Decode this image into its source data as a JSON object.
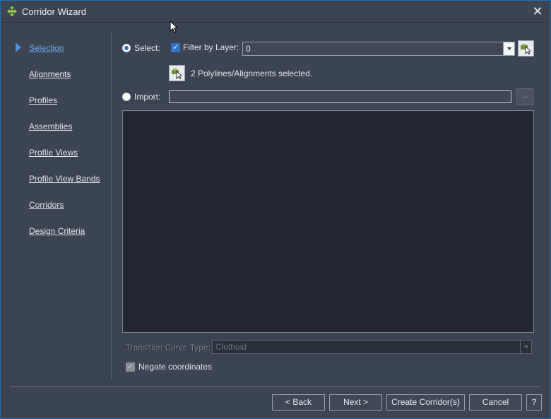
{
  "window": {
    "title": "Corridor Wizard",
    "close_glyph": "✕"
  },
  "nav": {
    "items": [
      {
        "label": "Selection",
        "active": true
      },
      {
        "label": "Alignments"
      },
      {
        "label": "Profiles"
      },
      {
        "label": "Assemblies"
      },
      {
        "label": "Profile Views"
      },
      {
        "label": "Profile View Bands"
      },
      {
        "label": "Corridors"
      },
      {
        "label": "Design Criteria"
      }
    ]
  },
  "selection": {
    "select_label": "Select:",
    "select_checked": true,
    "filter_label": "Filter by Layer:",
    "filter_checked": true,
    "layer_value": "0",
    "status_text": "2 Polylines/Alignments selected.",
    "import_label": "Import:",
    "import_value": "",
    "browse_label": "...",
    "transition_label": "Transition Curve Type:",
    "transition_value": "Clothoid",
    "negate_label": "Negate coordinates",
    "negate_checked": true
  },
  "buttons": {
    "back": "< Back",
    "next": "Next >",
    "create": "Create Corridor(s)",
    "cancel": "Cancel",
    "help": "?"
  },
  "colors": {
    "background": "#3b4453",
    "accent": "#2d72c8",
    "link_active": "#6aa9ef",
    "panel": "#222733"
  }
}
